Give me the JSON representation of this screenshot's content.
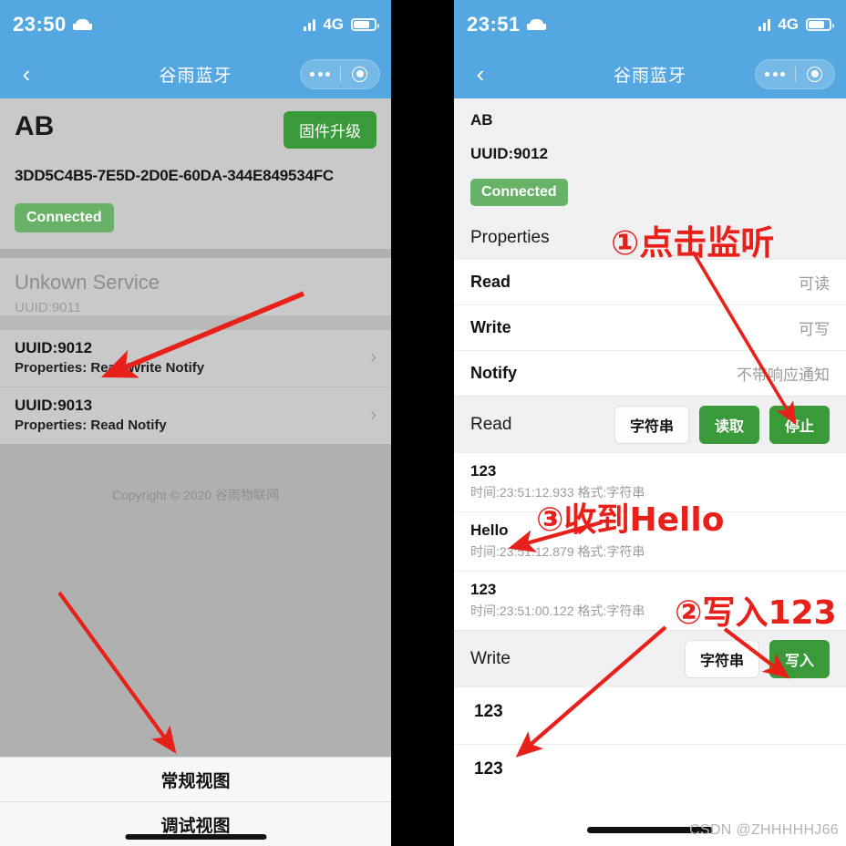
{
  "left": {
    "status": {
      "time": "23:50",
      "network": "4G",
      "bed_icon": "bed-icon"
    },
    "nav": {
      "back_icon": "chevron-left-icon",
      "title": "谷雨蓝牙",
      "more_icon": "more-dots-icon",
      "target_icon": "target-icon"
    },
    "device": {
      "name": "AB",
      "upgrade_button": "固件升级",
      "uuid": "3DD5C4B5-7E5D-2D0E-60DA-344E849534FC",
      "status_badge": "Connected"
    },
    "service": {
      "name": "Unkown Service",
      "uuid": "UUID:9011",
      "characteristics": [
        {
          "uuid": "UUID:9012",
          "properties": "Properties: Read Write Notify",
          "chevron": "chevron-right-icon"
        },
        {
          "uuid": "UUID:9013",
          "properties": "Properties: Read Notify",
          "chevron": "chevron-right-icon"
        }
      ]
    },
    "copyright": "Copyright © 2020 谷雨物联网",
    "tabs": [
      {
        "label": "常规视图"
      },
      {
        "label": "调试视图"
      }
    ]
  },
  "right": {
    "status": {
      "time": "23:51",
      "network": "4G",
      "bed_icon": "bed-icon"
    },
    "nav": {
      "back_icon": "chevron-left-icon",
      "title": "谷雨蓝牙",
      "more_icon": "more-dots-icon",
      "target_icon": "target-icon"
    },
    "device": {
      "name": "AB",
      "uuid": "UUID:9012",
      "status_badge": "Connected"
    },
    "properties_title": "Properties",
    "properties": [
      {
        "key": "Read",
        "value": "可读"
      },
      {
        "key": "Write",
        "value": "可写"
      },
      {
        "key": "Notify",
        "value": "不带响应通知"
      }
    ],
    "read_action": {
      "label": "Read",
      "format_button": "字符串",
      "read_button": "读取",
      "stop_button": "停止"
    },
    "read_logs": [
      {
        "value": "123",
        "meta": "时间:23:51:12.933 格式:字符串"
      },
      {
        "value": "Hello",
        "meta": "时间:23:51:12.879 格式:字符串"
      },
      {
        "value": "123",
        "meta": "时间:23:51:00.122 格式:字符串"
      }
    ],
    "write_action": {
      "label": "Write",
      "format_button": "字符串",
      "write_button": "写入"
    },
    "write_logs": [
      {
        "value": "123"
      },
      {
        "value": "123"
      }
    ]
  },
  "annotations": [
    {
      "id": "annot-1",
      "text": "①点击监听"
    },
    {
      "id": "annot-3",
      "text": "③收到Hello"
    },
    {
      "id": "annot-2",
      "text": "②写入123"
    }
  ],
  "watermark": "CSDN @ZHHHHHJ66",
  "colors": {
    "nav_blue": "#54a7e0",
    "green_button": "#3a9a3a",
    "green_badge": "#68b268",
    "annotation_red": "#e8201a",
    "left_bg": "#b9b9b9",
    "left_card": "#c9c9c9"
  }
}
